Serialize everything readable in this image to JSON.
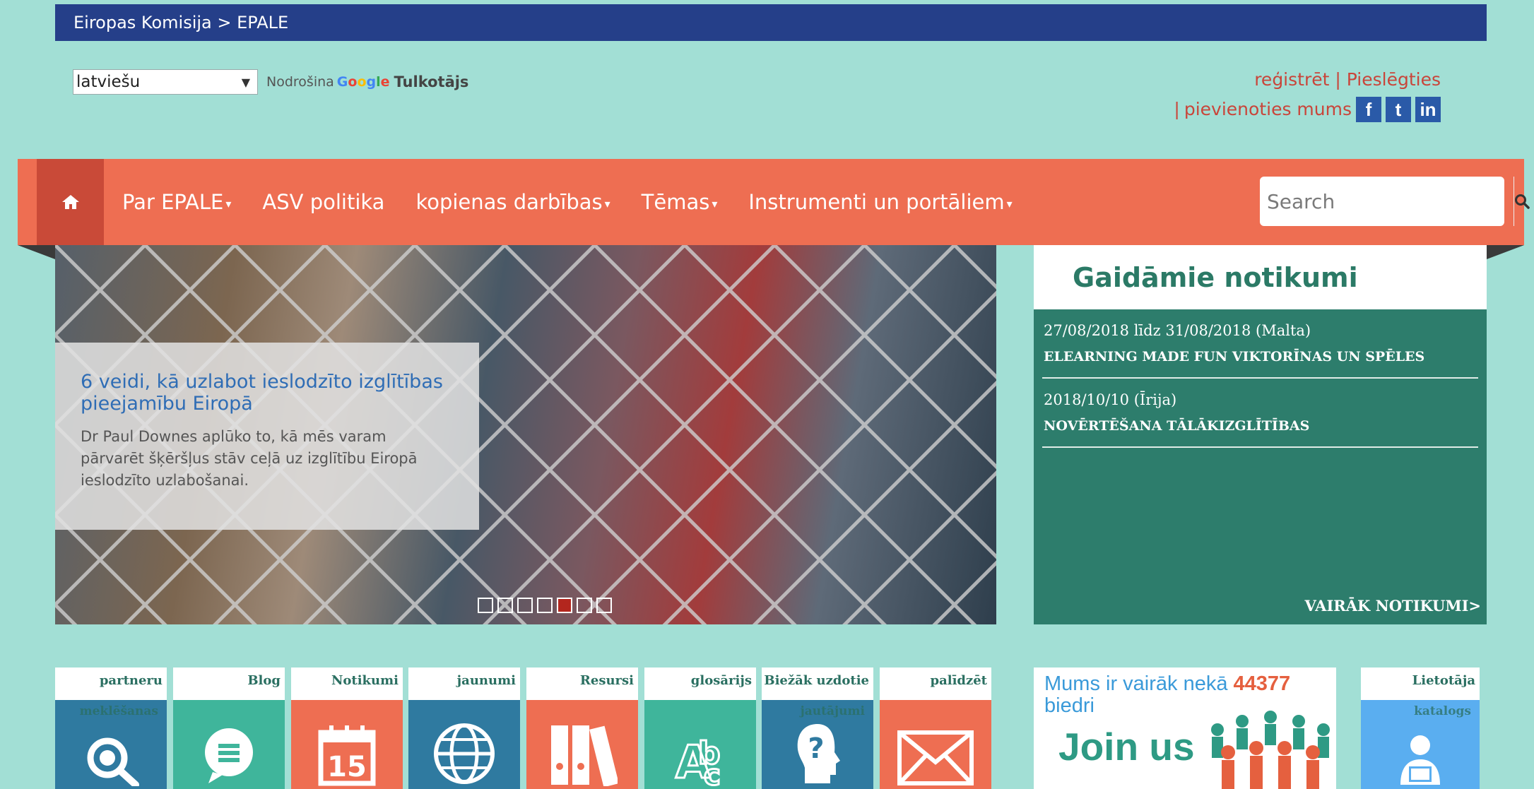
{
  "topbar": {
    "breadcrumb": "Eiropas Komisija > EPALE"
  },
  "translate": {
    "language": "latviešu",
    "powered_by": "Nodrošina",
    "google_letters": [
      "G",
      "o",
      "o",
      "g",
      "l",
      "e"
    ],
    "translate_label": "Tulkotājs"
  },
  "user_links": {
    "register": "reģistrēt",
    "separator": "|",
    "login": "Pieslēgties",
    "join_prefix": "|",
    "join": "pievienoties mums"
  },
  "social": [
    {
      "icon": "facebook-icon",
      "glyph": "f"
    },
    {
      "icon": "twitter-icon",
      "glyph": "t"
    },
    {
      "icon": "linkedin-icon",
      "glyph": "in"
    }
  ],
  "nav": {
    "home_icon": "home-icon",
    "items": [
      {
        "label": "Par EPALE",
        "dropdown": true
      },
      {
        "label": "ASV politika",
        "dropdown": false
      },
      {
        "label": "kopienas darbības",
        "dropdown": true
      },
      {
        "label": "Tēmas",
        "dropdown": true
      },
      {
        "label": "Instrumenti un portāliem",
        "dropdown": true
      }
    ],
    "search_placeholder": "Search"
  },
  "hero": {
    "title": "6 veidi, kā uzlabot ieslodzīto izglītības pieejamību Eiropā",
    "text": "Dr Paul Downes aplūko to, kā mēs varam pārvarēt šķēršļus stāv ceļā uz izglītību Eiropā ieslodzīto uzlabošanai.",
    "slide_count": 7,
    "active_slide": 5
  },
  "events": {
    "heading": "Gaidāmie notikumi",
    "items": [
      {
        "date": "27/08/2018 līdz 31/08/2018 (Malta)",
        "title": "ELEARNING MADE FUN VIKTORĪNAS UN SPĒLES"
      },
      {
        "date": "2018/10/10 (Īrija)",
        "title": "NOVĒRTĒŠANA TĀLĀKIZGLĪTĪBAS"
      }
    ],
    "more": "VAIRĀK NOTIKUMI>"
  },
  "tiles": [
    {
      "label": "partneru",
      "sub": "meklēšanas",
      "color": "#2f7aa0",
      "icon": "partner-search-icon"
    },
    {
      "label": "Blog",
      "sub": "",
      "color": "#3fb59b",
      "icon": "blog-icon"
    },
    {
      "label": "Notikumi",
      "sub": "",
      "color": "#ee6e52",
      "icon": "calendar-icon"
    },
    {
      "label": "jaunumi",
      "sub": "",
      "color": "#2f7aa0",
      "icon": "globe-icon"
    },
    {
      "label": "Resursi",
      "sub": "",
      "color": "#ee6e52",
      "icon": "resources-icon"
    },
    {
      "label": "glosārijs",
      "sub": "",
      "color": "#3fb59b",
      "icon": "glossary-icon"
    },
    {
      "label": "Biežāk uzdotie",
      "sub": "jautājumi",
      "color": "#2f7aa0",
      "icon": "faq-icon"
    },
    {
      "label": "palīdzēt",
      "sub": "",
      "color": "#ee6e52",
      "icon": "mail-icon"
    }
  ],
  "members": {
    "text_before": "Mums ir vairāk nekā ",
    "count": "44377",
    "text_after": "biedri",
    "join": "Join us"
  },
  "user_directory": {
    "label": "Lietotāja",
    "sub": "katalogs",
    "color": "#5aaef0",
    "icon": "user-directory-icon"
  },
  "colors": {
    "topbar": "#253f89",
    "nav": "#ee6e52",
    "events": "#2d7d6c",
    "background": "#a2dfd5"
  }
}
